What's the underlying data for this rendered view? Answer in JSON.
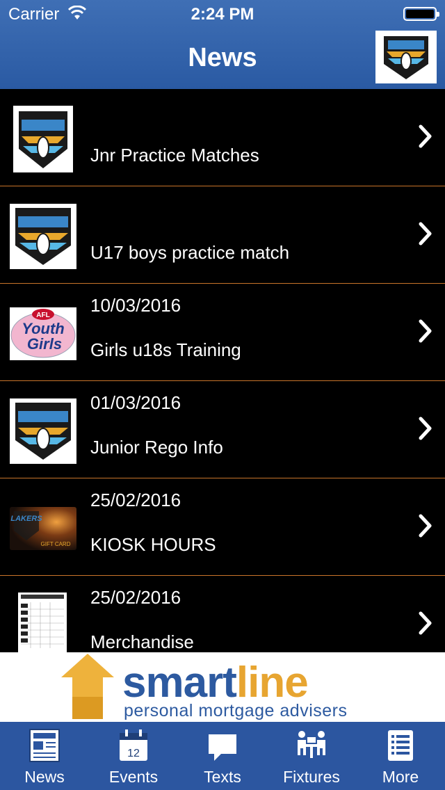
{
  "status_bar": {
    "carrier": "Carrier",
    "time": "2:24 PM"
  },
  "header": {
    "title": "News",
    "logo_icon": "lakers-logo-icon"
  },
  "news": [
    {
      "date": "",
      "title": "Jnr Practice Matches",
      "thumb": "lakers-logo"
    },
    {
      "date": "",
      "title": "U17 boys practice match",
      "thumb": "lakers-logo"
    },
    {
      "date": "10/03/2016",
      "title": "Girls u18s Training",
      "thumb": "afl-youth-girls-logo",
      "thumb_text": {
        "afl": "AFL",
        "line1": "Youth",
        "line2": "Girls"
      }
    },
    {
      "date": "01/03/2016",
      "title": "Junior Rego Info",
      "thumb": "lakers-logo"
    },
    {
      "date": "25/02/2016",
      "title": "KIOSK HOURS",
      "thumb": "gift-card",
      "thumb_text": {
        "brand": "LAKERS",
        "caption": "GIFT CARD"
      }
    },
    {
      "date": "25/02/2016",
      "title": "Merchandise",
      "thumb": "document-thumbnail"
    }
  ],
  "ad": {
    "brand_part1": "smart",
    "brand_part2": "line",
    "tagline": "personal mortgage advisers"
  },
  "tabs": [
    {
      "label": "News",
      "icon": "newspaper-icon"
    },
    {
      "label": "Events",
      "icon": "calendar-icon",
      "icon_text": "12"
    },
    {
      "label": "Texts",
      "icon": "speech-bubble-icon"
    },
    {
      "label": "Fixtures",
      "icon": "people-table-icon"
    },
    {
      "label": "More",
      "icon": "list-icon"
    }
  ],
  "colors": {
    "header": "#2f5fa8",
    "separator": "#c9742a",
    "tabbar": "#2c56a0",
    "ad_blue": "#2d5aa0",
    "ad_gold": "#e7a531"
  }
}
